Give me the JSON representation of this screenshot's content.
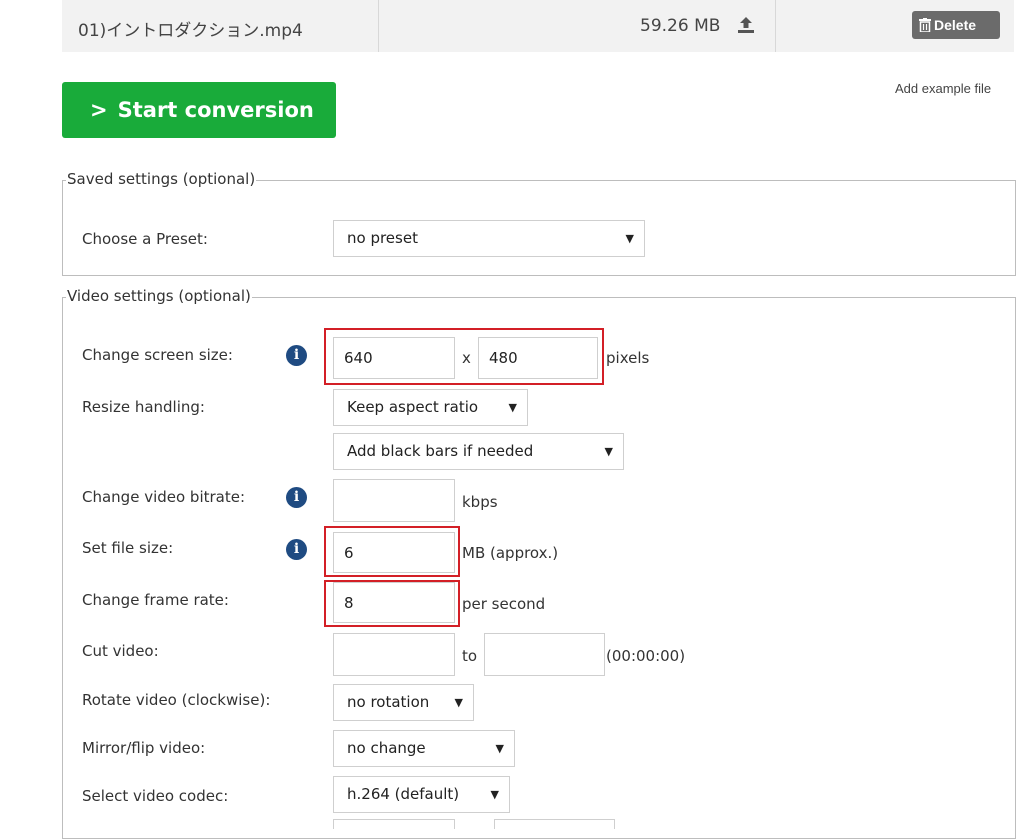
{
  "file": {
    "name": "01)イントロダクション.mp4",
    "size": "59.26 MB",
    "delete_label": "Delete"
  },
  "add_example_label": "Add example file",
  "start_button_label": "Start conversion",
  "saved_settings": {
    "legend": "Saved settings (optional)",
    "preset_label": "Choose a Preset:",
    "preset_value": "no preset"
  },
  "video_settings": {
    "legend": "Video settings (optional)",
    "screen_size_label": "Change screen size:",
    "width_value": "640",
    "x_separator": "x",
    "height_value": "480",
    "pixels_unit": "pixels",
    "resize_label": "Resize handling:",
    "resize_value": "Keep aspect ratio",
    "bars_value": "Add black bars if needed",
    "bitrate_label": "Change video bitrate:",
    "bitrate_value": "",
    "bitrate_unit": "kbps",
    "file_size_label": "Set file size:",
    "file_size_value": "6",
    "file_size_unit": "MB (approx.)",
    "frame_rate_label": "Change frame rate:",
    "frame_rate_value": "8",
    "frame_rate_unit": "per second",
    "cut_label": "Cut video:",
    "cut_to": "to",
    "cut_format": "(00:00:00)",
    "rotate_label": "Rotate video (clockwise):",
    "rotate_value": "no rotation",
    "mirror_label": "Mirror/flip video:",
    "mirror_value": "no change",
    "codec_label": "Select video codec:",
    "codec_value": "h.264 (default)"
  },
  "icons": {
    "upload": "upload-icon",
    "trash": "trash-icon",
    "info": "info-icon",
    "dropdown": "dropdown-arrow-icon"
  },
  "colors": {
    "start_button": "#19ab3a",
    "delete_button": "#6b6b6b",
    "highlight_border": "#d31f26",
    "info_icon": "#1f4b82"
  }
}
